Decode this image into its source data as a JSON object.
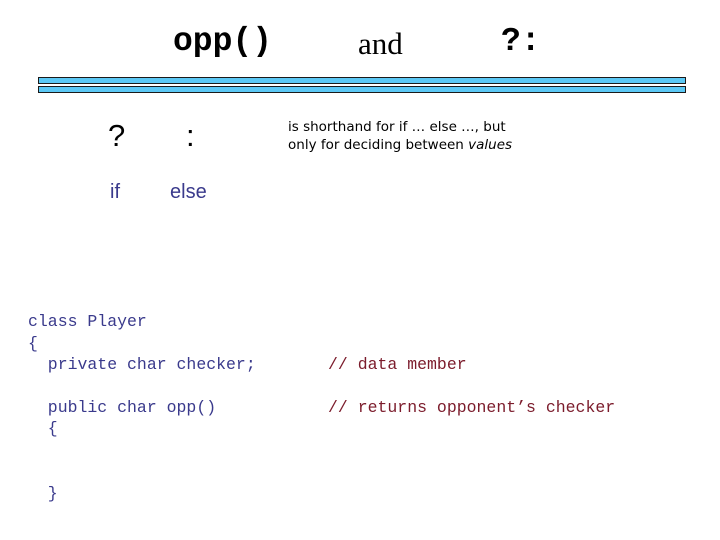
{
  "slide": {
    "title": {
      "part_mono_1": "opp()",
      "part_serif": "and",
      "part_mono_2": "?:"
    },
    "divider": {
      "color": "#5BC8F5",
      "border_color": "#1a1a1a",
      "bars": 2
    },
    "operator_demo": {
      "question_mark": "?",
      "colon": ":",
      "keyword_if": "if",
      "keyword_else": "else",
      "keyword_color": "#3A3A8C"
    },
    "note": {
      "line1_prefix": "is shorthand for ",
      "line1_if": "if",
      "line1_mid": " … ",
      "line1_else": "else",
      "line1_suffix": " …, but",
      "line2_prefix": "only for deciding between ",
      "line2_emphasis": "values"
    },
    "code": {
      "color": "#3A3A8C",
      "comment_color": "#7B1B2B",
      "lines": [
        {
          "text": "class Player",
          "comment": ""
        },
        {
          "text": "{",
          "comment": ""
        },
        {
          "text": "  private char checker;",
          "comment": "// data member"
        },
        {
          "text": "  public char opp()",
          "comment": "// returns opponent’s checker"
        },
        {
          "text": "  {",
          "comment": ""
        },
        {
          "text": "  }",
          "comment": ""
        }
      ]
    }
  }
}
